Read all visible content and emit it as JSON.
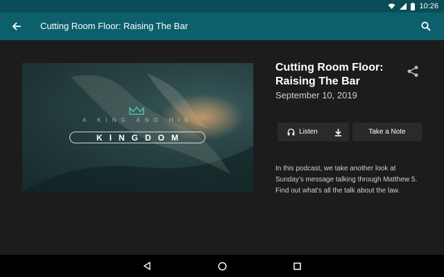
{
  "status_bar": {
    "time": "10:26",
    "icons": [
      "wifi-icon",
      "signal-icon",
      "battery-icon"
    ]
  },
  "app_bar": {
    "title": "Cutting Room Floor: Raising The Bar",
    "back_icon": "arrow-left-icon",
    "search_icon": "search-icon",
    "background": "#0d5f6b"
  },
  "artwork": {
    "subtitle": "A KING AND HIS",
    "title": "KINGDOM"
  },
  "episode": {
    "title": "Cutting Room Floor: Raising The Bar",
    "date": "September 10, 2019",
    "description": "In this podcast, we take another look at Sunday's message talking through Matthew 5. Find out what's all the talk about the law."
  },
  "actions": {
    "listen_label": "Listen",
    "take_note_label": "Take a Note",
    "share_icon": "share-icon",
    "download_icon": "download-icon",
    "headphones_icon": "headphones-icon"
  },
  "nav_bar": {
    "icons": [
      "back-triangle-icon",
      "home-circle-icon",
      "recents-square-icon"
    ]
  }
}
